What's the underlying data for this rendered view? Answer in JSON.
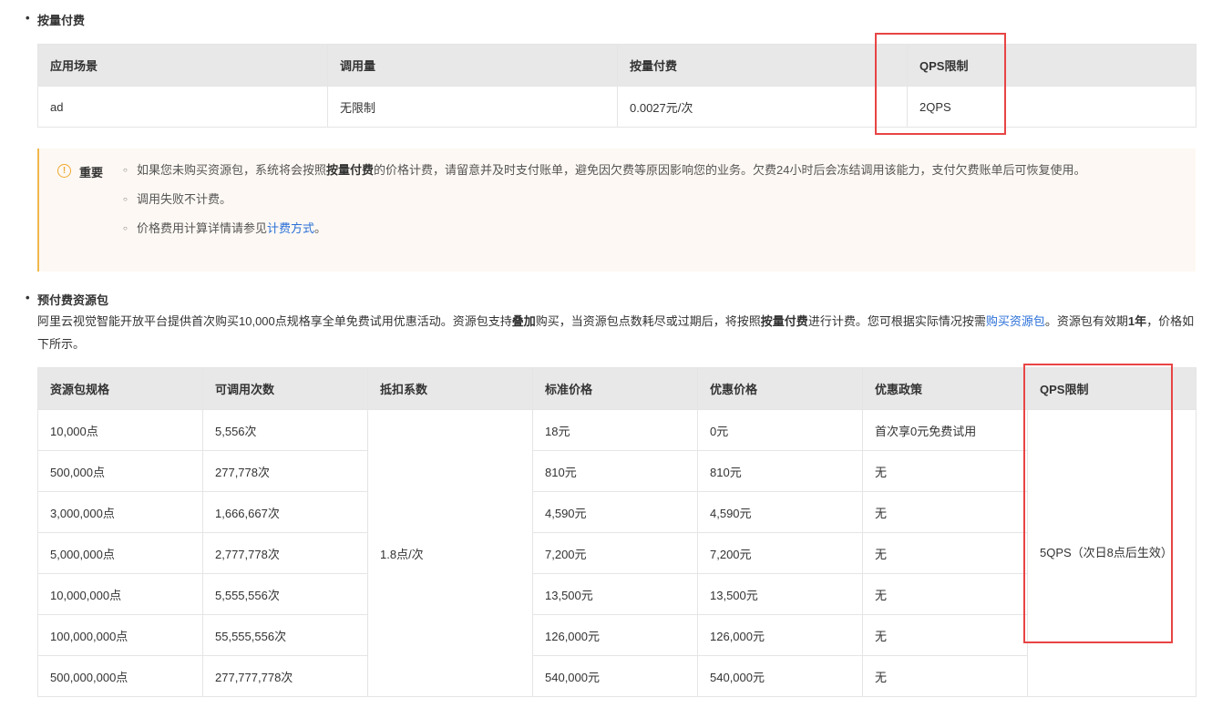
{
  "section1": {
    "title": "按量付费",
    "table": {
      "headers": [
        "应用场景",
        "调用量",
        "按量付费",
        "QPS限制"
      ],
      "rows": [
        [
          "ad",
          "无限制",
          "0.0027元/次",
          "2QPS"
        ]
      ]
    }
  },
  "notice": {
    "title": "重要",
    "items": [
      {
        "pre": "如果您未购买资源包，系统将会按照",
        "bold": "按量付费",
        "post": "的价格计费，请留意并及时支付账单，避免因欠费等原因影响您的业务。欠费24小时后会冻结调用该能力，支付欠费账单后可恢复使用。"
      },
      {
        "text": "调用失败不计费。"
      },
      {
        "pre": "价格费用计算详情请参见",
        "link": "计费方式",
        "post": "。"
      }
    ]
  },
  "section2": {
    "title": "预付费资源包",
    "para": {
      "p1": "阿里云视觉智能开放平台提供首次购买10,000点规格享全单免费试用优惠活动。资源包支持",
      "b1": "叠加",
      "p2": "购买，当资源包点数耗尽或过期后，将按照",
      "b2": "按量付费",
      "p3": "进行计费。您可根据实际情况按需",
      "link": "购买资源包",
      "p4": "。资源包有效期",
      "b3": "1年",
      "p5": "，价格如下所示。"
    },
    "table": {
      "headers": [
        "资源包规格",
        "可调用次数",
        "抵扣系数",
        "标准价格",
        "优惠价格",
        "优惠政策",
        "QPS限制"
      ],
      "deduction": "1.8点/次",
      "qps": "5QPS（次日8点后生效）",
      "rows": [
        [
          "10,000点",
          "5,556次",
          "18元",
          "0元",
          "首次享0元免费试用"
        ],
        [
          "500,000点",
          "277,778次",
          "810元",
          "810元",
          "无"
        ],
        [
          "3,000,000点",
          "1,666,667次",
          "4,590元",
          "4,590元",
          "无"
        ],
        [
          "5,000,000点",
          "2,777,778次",
          "7,200元",
          "7,200元",
          "无"
        ],
        [
          "10,000,000点",
          "5,555,556次",
          "13,500元",
          "13,500元",
          "无"
        ],
        [
          "100,000,000点",
          "55,555,556次",
          "126,000元",
          "126,000元",
          "无"
        ],
        [
          "500,000,000点",
          "277,777,778次",
          "540,000元",
          "540,000元",
          "无"
        ]
      ]
    }
  },
  "colors": {
    "highlight": "#e84444",
    "link": "#2a6fd8",
    "notice_bg": "#fdf8f3",
    "notice_border": "#f0b94c"
  }
}
